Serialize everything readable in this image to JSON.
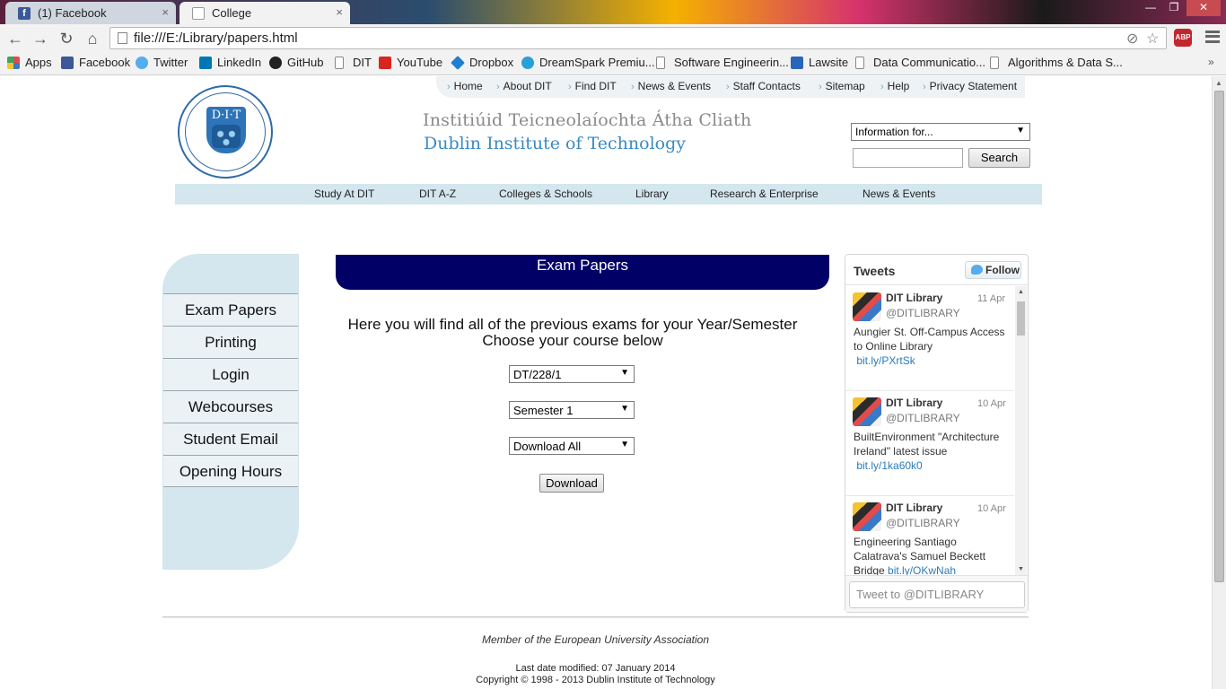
{
  "browser": {
    "tabs": [
      {
        "title": "(1) Facebook",
        "favicon": "facebook-icon"
      },
      {
        "title": "College",
        "favicon": "page-icon"
      }
    ],
    "tab_close": "×",
    "window_controls": {
      "minimize": "—",
      "restore": "❐",
      "close": "✕"
    },
    "address": "file:///E:/Library/papers.html",
    "extension_badge": "ABP",
    "bookmarks": [
      {
        "label": "Apps",
        "icon": "apps-grid-icon"
      },
      {
        "label": "Facebook",
        "icon": "facebook-icon"
      },
      {
        "label": "Twitter",
        "icon": "twitter-icon"
      },
      {
        "label": "LinkedIn",
        "icon": "linkedin-icon"
      },
      {
        "label": "GitHub",
        "icon": "github-icon"
      },
      {
        "label": "DIT",
        "icon": "page-icon"
      },
      {
        "label": "YouTube",
        "icon": "youtube-icon"
      },
      {
        "label": "Dropbox",
        "icon": "dropbox-icon"
      },
      {
        "label": "DreamSpark Premiu...",
        "icon": "dreamspark-icon"
      },
      {
        "label": "Software Engineerin...",
        "icon": "page-icon"
      },
      {
        "label": "Lawsite",
        "icon": "lawsite-icon"
      },
      {
        "label": "Data Communicatio...",
        "icon": "page-icon"
      },
      {
        "label": "Algorithms & Data S...",
        "icon": "page-icon"
      }
    ],
    "bookmarks_more": "»"
  },
  "header": {
    "top_links": [
      "Home",
      "About DIT",
      "Find DIT",
      "News & Events",
      "Staff Contacts",
      "Sitemap",
      "Help",
      "Privacy Statement"
    ],
    "logo_text": "D·I·T",
    "name_irish": "Institiúid Teicneolaíochta Átha Cliath",
    "name_english": "Dublin Institute of Technology",
    "info_select": "Information for...",
    "search_value": "",
    "search_button": "Search",
    "main_nav": [
      "Study At DIT",
      "DIT A-Z",
      "Colleges & Schools",
      "Library",
      "Research & Enterprise",
      "News & Events"
    ]
  },
  "sidebar": {
    "items": [
      "Exam Papers",
      "Printing",
      "Login",
      "Webcourses",
      "Student Email",
      "Opening Hours"
    ]
  },
  "main": {
    "banner": "Exam Papers",
    "intro_line1": "Here you will find all of the previous exams for your Year/Semester",
    "intro_line2": "Choose your course below",
    "course_select": "DT/228/1",
    "semester_select": "Semester 1",
    "download_select": "Download All",
    "download_button": "Download",
    "caret": "▼"
  },
  "tweets": {
    "title": "Tweets",
    "follow": "Follow",
    "items": [
      {
        "name": "DIT Library",
        "handle": "@DITLIBRARY",
        "date": "11 Apr",
        "text": "Aungier St. Off-Campus Access to Online Library",
        "link": "bit.ly/PXrtSk"
      },
      {
        "name": "DIT Library",
        "handle": "@DITLIBRARY",
        "date": "10 Apr",
        "text": "BuiltEnvironment \"Architecture Ireland\" latest issue",
        "link": "bit.ly/1ka60k0"
      },
      {
        "name": "DIT Library",
        "handle": "@DITLIBRARY",
        "date": "10 Apr",
        "text": "Engineering Santiago Calatrava's Samuel Beckett Bridge",
        "link": "bit.ly/OKwNah"
      }
    ],
    "compose_placeholder": "Tweet to @DITLIBRARY"
  },
  "footer": {
    "member": "Member of the European University Association",
    "modified": "Last date modified: 07 January 2014",
    "copyright": "Copyright © 1998 - 2013 Dublin Institute of Technology"
  },
  "colors": {
    "banner": "#000066",
    "nav_bg": "#d4e6ee",
    "link_blue": "#2b7bb9",
    "title_blue": "#3a8ac4"
  }
}
